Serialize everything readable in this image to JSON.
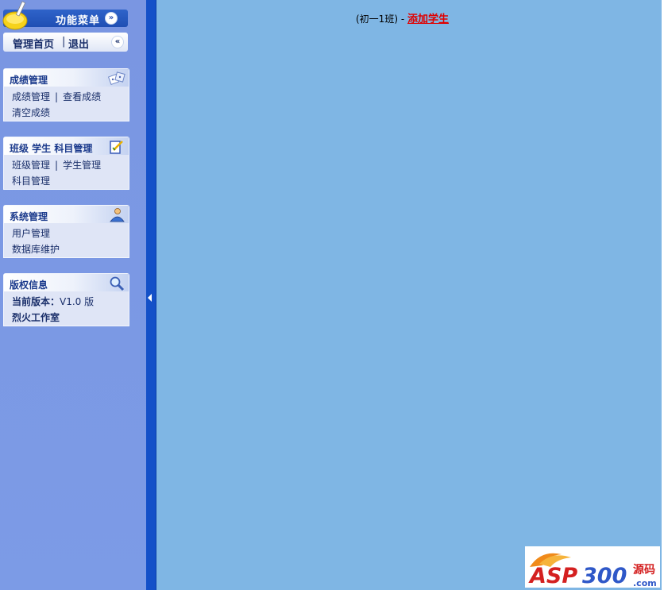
{
  "menu": {
    "title": "功能菜单",
    "expand_icon": "double-chevron-down-icon",
    "home": "管理首页",
    "separator": "|",
    "logout": "退出",
    "collapse_icon": "double-chevron-left-icon"
  },
  "panels": [
    {
      "title": "成绩管理",
      "icon": "dice-icon",
      "rows": [
        [
          "成绩管理",
          "查看成绩"
        ],
        [
          "清空成绩"
        ]
      ]
    },
    {
      "title": "班级 学生 科目管理",
      "icon": "edit-document-icon",
      "rows": [
        [
          "班级管理",
          "学生管理"
        ],
        [
          "科目管理"
        ]
      ]
    },
    {
      "title": "系统管理",
      "icon": "user-admin-icon",
      "rows": [
        [
          "用户管理"
        ],
        [
          "数据库维护"
        ]
      ]
    },
    {
      "title": "版权信息",
      "icon": "magnifier-icon",
      "version_label": "当前版本：",
      "version_value": "V1.0 版",
      "studio": "烈火工作室"
    }
  ],
  "main": {
    "class_text": "(初一1班) - ",
    "add_link": "添加学生"
  },
  "logo": {
    "text": "ASP300",
    "sub": "源码",
    "domain": ".com"
  },
  "colors": {
    "sidebar_bg": "#7a96e2",
    "splitter": "#1450c8",
    "main_bg": "#7fb6e4",
    "link_red": "#e00000"
  }
}
